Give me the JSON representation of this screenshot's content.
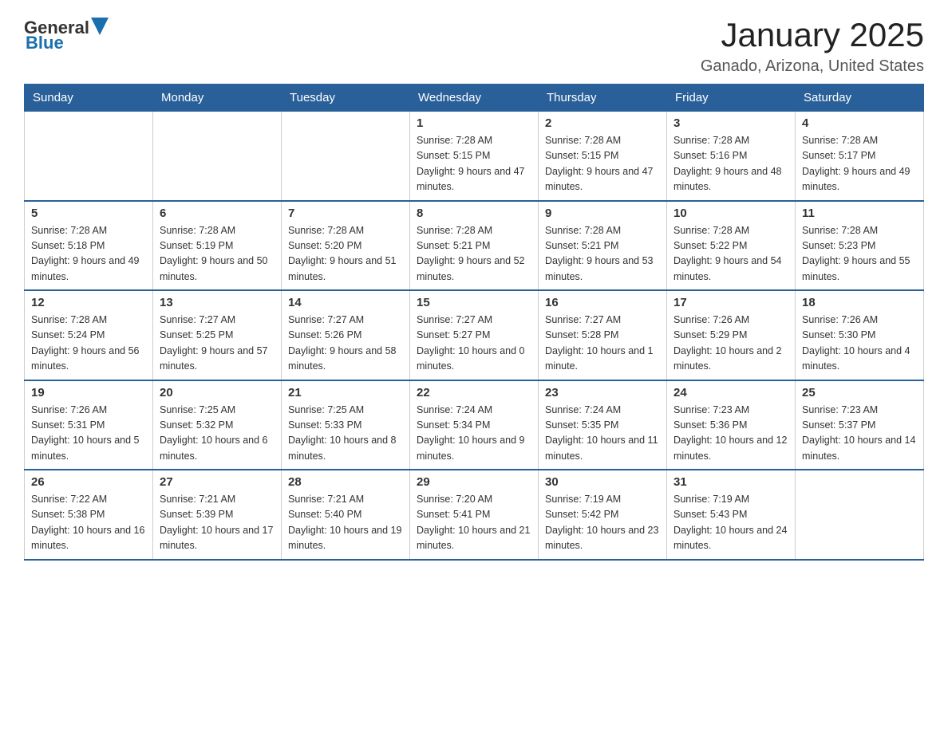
{
  "logo": {
    "text_general": "General",
    "text_blue": "Blue"
  },
  "header": {
    "month_title": "January 2025",
    "location": "Ganado, Arizona, United States"
  },
  "weekdays": [
    "Sunday",
    "Monday",
    "Tuesday",
    "Wednesday",
    "Thursday",
    "Friday",
    "Saturday"
  ],
  "weeks": [
    [
      {
        "day": "",
        "info": ""
      },
      {
        "day": "",
        "info": ""
      },
      {
        "day": "",
        "info": ""
      },
      {
        "day": "1",
        "info": "Sunrise: 7:28 AM\nSunset: 5:15 PM\nDaylight: 9 hours and 47 minutes."
      },
      {
        "day": "2",
        "info": "Sunrise: 7:28 AM\nSunset: 5:15 PM\nDaylight: 9 hours and 47 minutes."
      },
      {
        "day": "3",
        "info": "Sunrise: 7:28 AM\nSunset: 5:16 PM\nDaylight: 9 hours and 48 minutes."
      },
      {
        "day": "4",
        "info": "Sunrise: 7:28 AM\nSunset: 5:17 PM\nDaylight: 9 hours and 49 minutes."
      }
    ],
    [
      {
        "day": "5",
        "info": "Sunrise: 7:28 AM\nSunset: 5:18 PM\nDaylight: 9 hours and 49 minutes."
      },
      {
        "day": "6",
        "info": "Sunrise: 7:28 AM\nSunset: 5:19 PM\nDaylight: 9 hours and 50 minutes."
      },
      {
        "day": "7",
        "info": "Sunrise: 7:28 AM\nSunset: 5:20 PM\nDaylight: 9 hours and 51 minutes."
      },
      {
        "day": "8",
        "info": "Sunrise: 7:28 AM\nSunset: 5:21 PM\nDaylight: 9 hours and 52 minutes."
      },
      {
        "day": "9",
        "info": "Sunrise: 7:28 AM\nSunset: 5:21 PM\nDaylight: 9 hours and 53 minutes."
      },
      {
        "day": "10",
        "info": "Sunrise: 7:28 AM\nSunset: 5:22 PM\nDaylight: 9 hours and 54 minutes."
      },
      {
        "day": "11",
        "info": "Sunrise: 7:28 AM\nSunset: 5:23 PM\nDaylight: 9 hours and 55 minutes."
      }
    ],
    [
      {
        "day": "12",
        "info": "Sunrise: 7:28 AM\nSunset: 5:24 PM\nDaylight: 9 hours and 56 minutes."
      },
      {
        "day": "13",
        "info": "Sunrise: 7:27 AM\nSunset: 5:25 PM\nDaylight: 9 hours and 57 minutes."
      },
      {
        "day": "14",
        "info": "Sunrise: 7:27 AM\nSunset: 5:26 PM\nDaylight: 9 hours and 58 minutes."
      },
      {
        "day": "15",
        "info": "Sunrise: 7:27 AM\nSunset: 5:27 PM\nDaylight: 10 hours and 0 minutes."
      },
      {
        "day": "16",
        "info": "Sunrise: 7:27 AM\nSunset: 5:28 PM\nDaylight: 10 hours and 1 minute."
      },
      {
        "day": "17",
        "info": "Sunrise: 7:26 AM\nSunset: 5:29 PM\nDaylight: 10 hours and 2 minutes."
      },
      {
        "day": "18",
        "info": "Sunrise: 7:26 AM\nSunset: 5:30 PM\nDaylight: 10 hours and 4 minutes."
      }
    ],
    [
      {
        "day": "19",
        "info": "Sunrise: 7:26 AM\nSunset: 5:31 PM\nDaylight: 10 hours and 5 minutes."
      },
      {
        "day": "20",
        "info": "Sunrise: 7:25 AM\nSunset: 5:32 PM\nDaylight: 10 hours and 6 minutes."
      },
      {
        "day": "21",
        "info": "Sunrise: 7:25 AM\nSunset: 5:33 PM\nDaylight: 10 hours and 8 minutes."
      },
      {
        "day": "22",
        "info": "Sunrise: 7:24 AM\nSunset: 5:34 PM\nDaylight: 10 hours and 9 minutes."
      },
      {
        "day": "23",
        "info": "Sunrise: 7:24 AM\nSunset: 5:35 PM\nDaylight: 10 hours and 11 minutes."
      },
      {
        "day": "24",
        "info": "Sunrise: 7:23 AM\nSunset: 5:36 PM\nDaylight: 10 hours and 12 minutes."
      },
      {
        "day": "25",
        "info": "Sunrise: 7:23 AM\nSunset: 5:37 PM\nDaylight: 10 hours and 14 minutes."
      }
    ],
    [
      {
        "day": "26",
        "info": "Sunrise: 7:22 AM\nSunset: 5:38 PM\nDaylight: 10 hours and 16 minutes."
      },
      {
        "day": "27",
        "info": "Sunrise: 7:21 AM\nSunset: 5:39 PM\nDaylight: 10 hours and 17 minutes."
      },
      {
        "day": "28",
        "info": "Sunrise: 7:21 AM\nSunset: 5:40 PM\nDaylight: 10 hours and 19 minutes."
      },
      {
        "day": "29",
        "info": "Sunrise: 7:20 AM\nSunset: 5:41 PM\nDaylight: 10 hours and 21 minutes."
      },
      {
        "day": "30",
        "info": "Sunrise: 7:19 AM\nSunset: 5:42 PM\nDaylight: 10 hours and 23 minutes."
      },
      {
        "day": "31",
        "info": "Sunrise: 7:19 AM\nSunset: 5:43 PM\nDaylight: 10 hours and 24 minutes."
      },
      {
        "day": "",
        "info": ""
      }
    ]
  ]
}
